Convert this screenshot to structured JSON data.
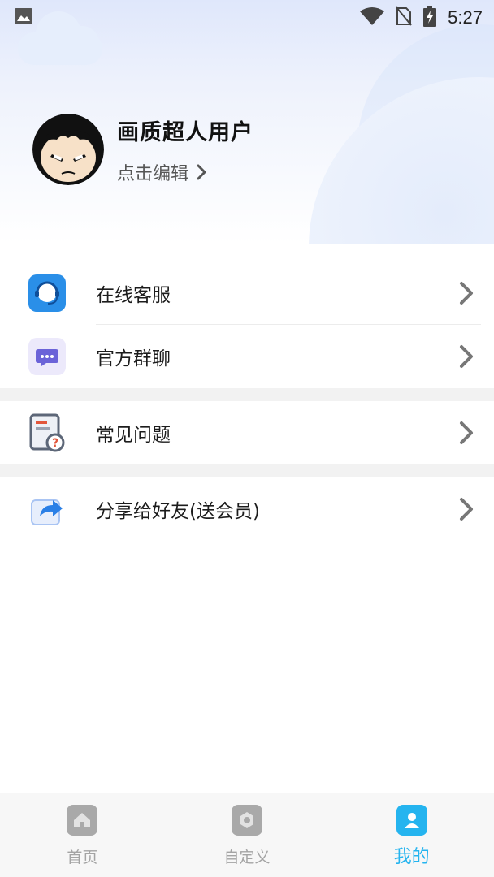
{
  "status_bar": {
    "time": "5:27",
    "icons": [
      "image-icon",
      "wifi-icon",
      "no-sim-icon",
      "battery-charging-icon"
    ]
  },
  "profile": {
    "name": "画质超人用户",
    "edit_label": "点击编辑",
    "avatar_icon": "superman-avatar"
  },
  "menu": [
    {
      "label": "在线客服",
      "icon": "customer-service-icon"
    },
    {
      "label": "官方群聊",
      "icon": "group-chat-icon"
    },
    {
      "label": "常见问题",
      "icon": "faq-icon"
    },
    {
      "label": "分享给好友(送会员)",
      "icon": "share-icon"
    }
  ],
  "bottom_nav": [
    {
      "label": "首页",
      "icon": "home-icon"
    },
    {
      "label": "自定义",
      "icon": "custom-icon"
    },
    {
      "label": "我的",
      "icon": "profile-icon",
      "active": true
    }
  ],
  "colors": {
    "accent": "#25b4ef",
    "inactive": "#a4a4a4",
    "service_blue": "#2a8fe8",
    "chat_purple": "#6b63d8",
    "faq_red": "#e2573c"
  }
}
